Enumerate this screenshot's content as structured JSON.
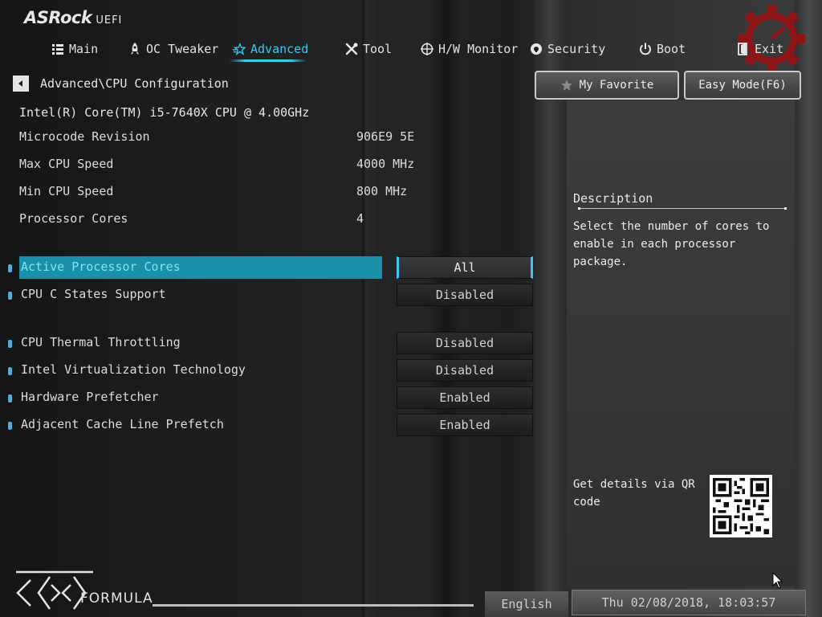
{
  "branding": {
    "brand": "ASRock",
    "suffix": "UEFI",
    "board_series": "FORMULA"
  },
  "nav": {
    "items": [
      {
        "label": "Main",
        "icon": "list-icon"
      },
      {
        "label": "OC Tweaker",
        "icon": "rocket-icon"
      },
      {
        "label": "Advanced",
        "icon": "star-icon",
        "active": true
      },
      {
        "label": "Tool",
        "icon": "tools-icon"
      },
      {
        "label": "H/W Monitor",
        "icon": "monitor-icon"
      },
      {
        "label": "Security",
        "icon": "shield-icon"
      },
      {
        "label": "Boot",
        "icon": "power-icon"
      },
      {
        "label": "Exit",
        "icon": "exit-icon"
      }
    ],
    "accent_color": "#3dc6ef"
  },
  "breadcrumb": {
    "path": "Advanced\\CPU Configuration"
  },
  "buttons": {
    "favorite": "My Favorite",
    "easy_mode": "Easy Mode(F6)"
  },
  "cpu": {
    "name": "Intel(R) Core(TM) i5-7640X CPU @ 4.00GHz",
    "info": [
      {
        "label": "Microcode Revision",
        "value": "906E9 5E"
      },
      {
        "label": "Max CPU Speed",
        "value": "4000 MHz"
      },
      {
        "label": "Min CPU Speed",
        "value": "800 MHz"
      },
      {
        "label": "Processor Cores",
        "value": "4"
      }
    ]
  },
  "options": [
    {
      "label": "Active Processor Cores",
      "value": "All",
      "selected": true
    },
    {
      "label": "CPU C States Support",
      "value": "Disabled"
    },
    {
      "label": "CPU Thermal Throttling",
      "value": "Disabled"
    },
    {
      "label": "Intel Virtualization Technology",
      "value": "Disabled"
    },
    {
      "label": "Hardware Prefetcher",
      "value": "Enabled"
    },
    {
      "label": "Adjacent Cache Line Prefetch",
      "value": "Enabled"
    }
  ],
  "description": {
    "title": "Description",
    "text": "Select the number of cores to enable in each processor package."
  },
  "qr": {
    "text": "Get details via QR code"
  },
  "footer": {
    "language": "English",
    "datetime": "Thu 02/08/2018, 18:03:57"
  }
}
